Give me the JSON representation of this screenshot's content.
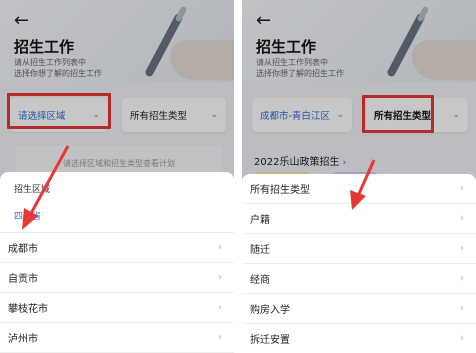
{
  "left": {
    "page_title": "招生工作",
    "subtitle_line1": "请从招生工作列表中",
    "subtitle_line2": "选择你想了解的招生工作",
    "region_selector": "请选择区域",
    "type_selector": "所有招生类型",
    "hint_text": "请选择区域和招生类型查看计划",
    "sheet": {
      "title": "招生区域",
      "province": "四川省",
      "items": [
        "成都市",
        "自贡市",
        "攀枝花市",
        "泸州市"
      ]
    }
  },
  "right": {
    "page_title": "招生工作",
    "subtitle_line1": "请从招生工作列表中",
    "subtitle_line2": "选择你想了解的招生工作",
    "region_selector": "成都市-青白江区",
    "type_selector": "所有招生类型",
    "policy_link": "2022乐山政策招生",
    "sheet": {
      "items": [
        "所有招生类型",
        "户籍",
        "随迁",
        "经商",
        "购房入学",
        "拆迁安置"
      ]
    }
  },
  "colors": {
    "accent_blue": "#2f6bd8",
    "highlight_red": "#e53935",
    "background": "#f1f3f6"
  },
  "icons": {
    "back": "left-arrow-icon",
    "chevron_down": "chevron-down-icon",
    "chevron_right": "chevron-right-icon"
  }
}
